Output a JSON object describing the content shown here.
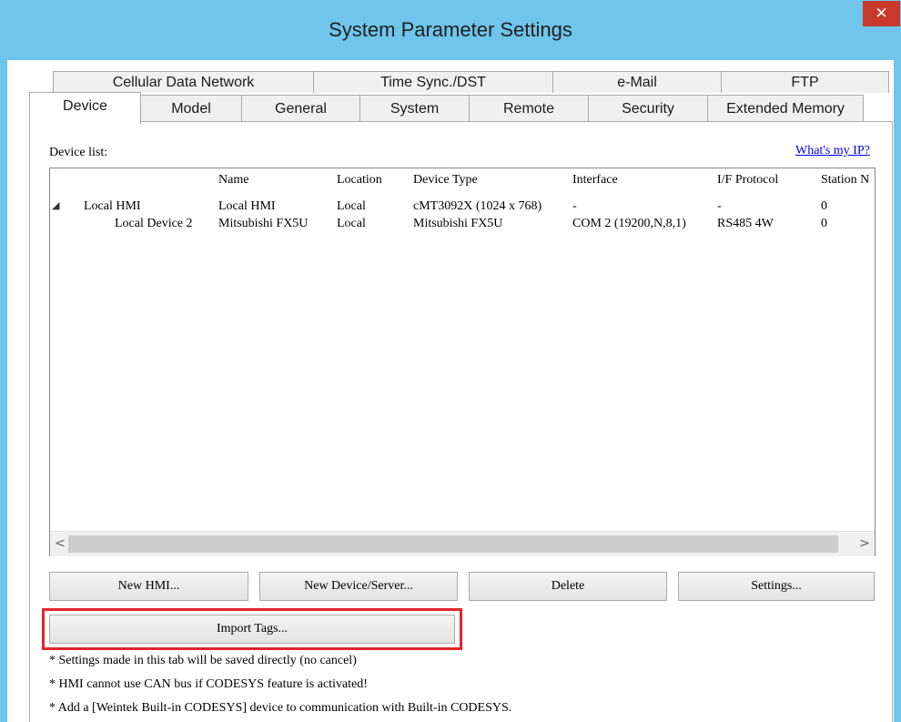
{
  "window": {
    "title": "System Parameter Settings",
    "close_glyph": "✕"
  },
  "tabs_row1": [
    "Cellular Data Network",
    "Time Sync./DST",
    "e-Mail",
    "FTP"
  ],
  "tabs_row2": [
    "Device",
    "Model",
    "General",
    "System",
    "Remote",
    "Security",
    "Extended Memory"
  ],
  "active_tab": "Device",
  "device_panel": {
    "list_label": "Device list:",
    "whats_my_ip": "What's my IP?",
    "columns": [
      "Name",
      "Location",
      "Device Type",
      "Interface",
      "I/F Protocol",
      "Station N"
    ],
    "rows": [
      {
        "tree": "Local HMI",
        "name": "Local HMI",
        "location": "Local",
        "device_type": "cMT3092X (1024 x 768)",
        "interface": "-",
        "protocol": "-",
        "station": "0"
      },
      {
        "tree": "Local Device 2",
        "name": "Mitsubishi FX5U",
        "location": "Local",
        "device_type": "Mitsubishi FX5U",
        "interface": "COM 2 (19200,N,8,1)",
        "protocol": "RS485 4W",
        "station": "0"
      }
    ],
    "scroll_left": "<",
    "scroll_right": ">",
    "buttons": {
      "new_hmi": "New HMI...",
      "new_device": "New Device/Server...",
      "delete": "Delete",
      "settings": "Settings...",
      "import_tags": "Import Tags..."
    },
    "notes": [
      "* Settings made in this tab will be saved directly (no cancel)",
      "* HMI cannot use CAN bus if CODESYS feature is activated!",
      "* Add a [Weintek Built-in CODESYS] device to communication with Built-in CODESYS."
    ]
  },
  "colors": {
    "title_bar": "#6fc5eb",
    "close_button": "#c7392b",
    "selection": "#cde8f6",
    "hmi_node": "#a4a8f0",
    "highlight": "#e3242b",
    "link": "#0000ee"
  },
  "icons": {
    "close": "close-icon",
    "expander": "collapse-triangle-icon"
  }
}
